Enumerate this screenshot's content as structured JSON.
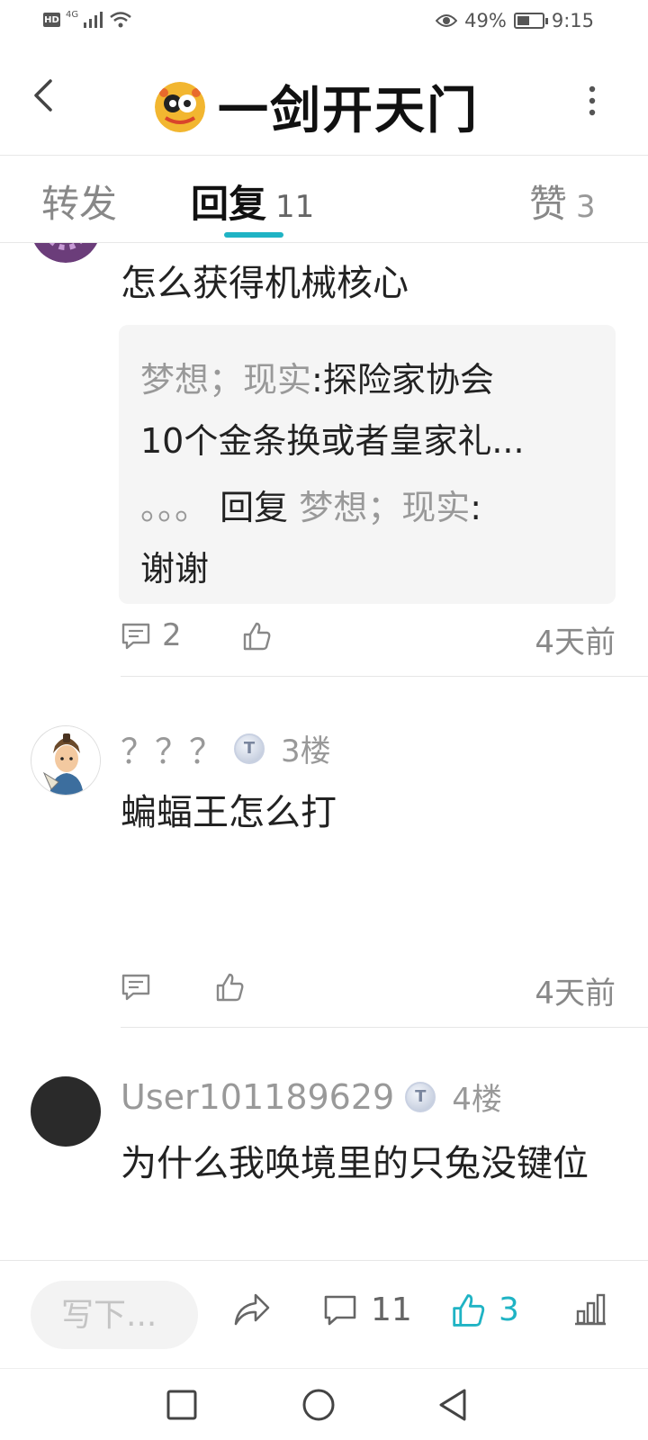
{
  "status_bar": {
    "hd": "HD",
    "network": "4G",
    "battery_percent": "49%",
    "battery_level": 0.49,
    "time": "9:15"
  },
  "header": {
    "title": "一剑开天门"
  },
  "tabs": [
    {
      "label": "转发",
      "count": ""
    },
    {
      "label": "回复",
      "count": "11"
    },
    {
      "label": "赞",
      "count": "3"
    }
  ],
  "active_tab": 1,
  "posts": [
    {
      "text": "怎么获得机械核心",
      "quote": {
        "line1_user": "梦想；现实",
        "line1_text": ":探险家协会",
        "line2_text": "10个金条换或者皇家礼...",
        "line3_dots": "。。。",
        "line3_reply": "回复",
        "line3_user": "梦想；现实",
        "line3_colon": ":",
        "line4_text": "谢谢"
      },
      "comment_count": "2",
      "time": "4天前"
    },
    {
      "username": "？？？",
      "floor": "3楼",
      "text": "蝙蝠王怎么打",
      "time": "4天前"
    },
    {
      "username": "User101189629",
      "floor": "4楼",
      "text": "为什么我唤境里的只兔没键位"
    }
  ],
  "bottom_bar": {
    "reply_placeholder": "写下...",
    "comments": "11",
    "likes": "3"
  },
  "colors": {
    "accent": "#1fb3c4",
    "gray_text": "#999999",
    "quote_bg": "#f5f5f5"
  }
}
